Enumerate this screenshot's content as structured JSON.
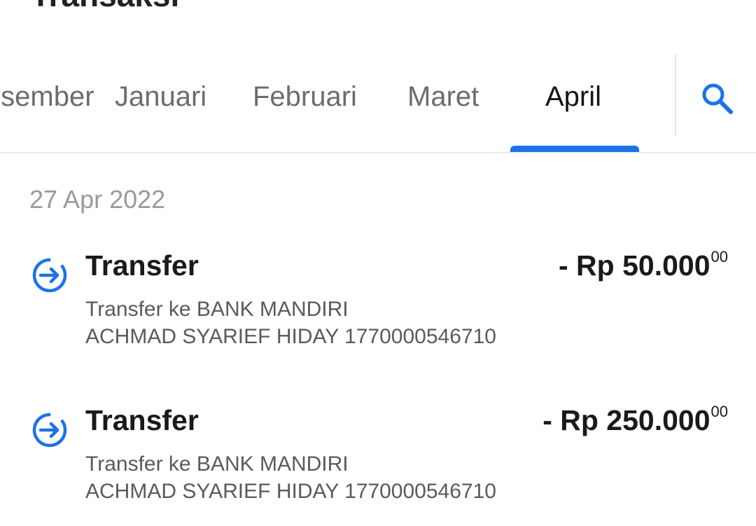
{
  "header": {
    "title": "Transaksi"
  },
  "tabs": [
    {
      "label": "Desember",
      "active": false
    },
    {
      "label": "Januari",
      "active": false
    },
    {
      "label": "Februari",
      "active": false
    },
    {
      "label": "Maret",
      "active": false
    },
    {
      "label": "April",
      "active": true
    }
  ],
  "search": {
    "icon": "search-icon"
  },
  "colors": {
    "accent": "#1a73e8",
    "text": "#1a1a1a",
    "secondary_text": "#5a5a5a",
    "date_text": "#9a9a9a"
  },
  "groups": [
    {
      "date": "27 Apr 2022",
      "transactions": [
        {
          "icon": "transfer-out-icon",
          "title": "Transfer",
          "desc_line1": "Transfer ke BANK MANDIRI",
          "desc_line2": "ACHMAD SYARIEF HIDAY 1770000546710",
          "amount": "- Rp 50.000",
          "amount_decimals": "00"
        },
        {
          "icon": "transfer-out-icon",
          "title": "Transfer",
          "desc_line1": "Transfer ke BANK MANDIRI",
          "desc_line2": "ACHMAD SYARIEF HIDAY 1770000546710",
          "amount": "- Rp 250.000",
          "amount_decimals": "00"
        }
      ]
    }
  ]
}
